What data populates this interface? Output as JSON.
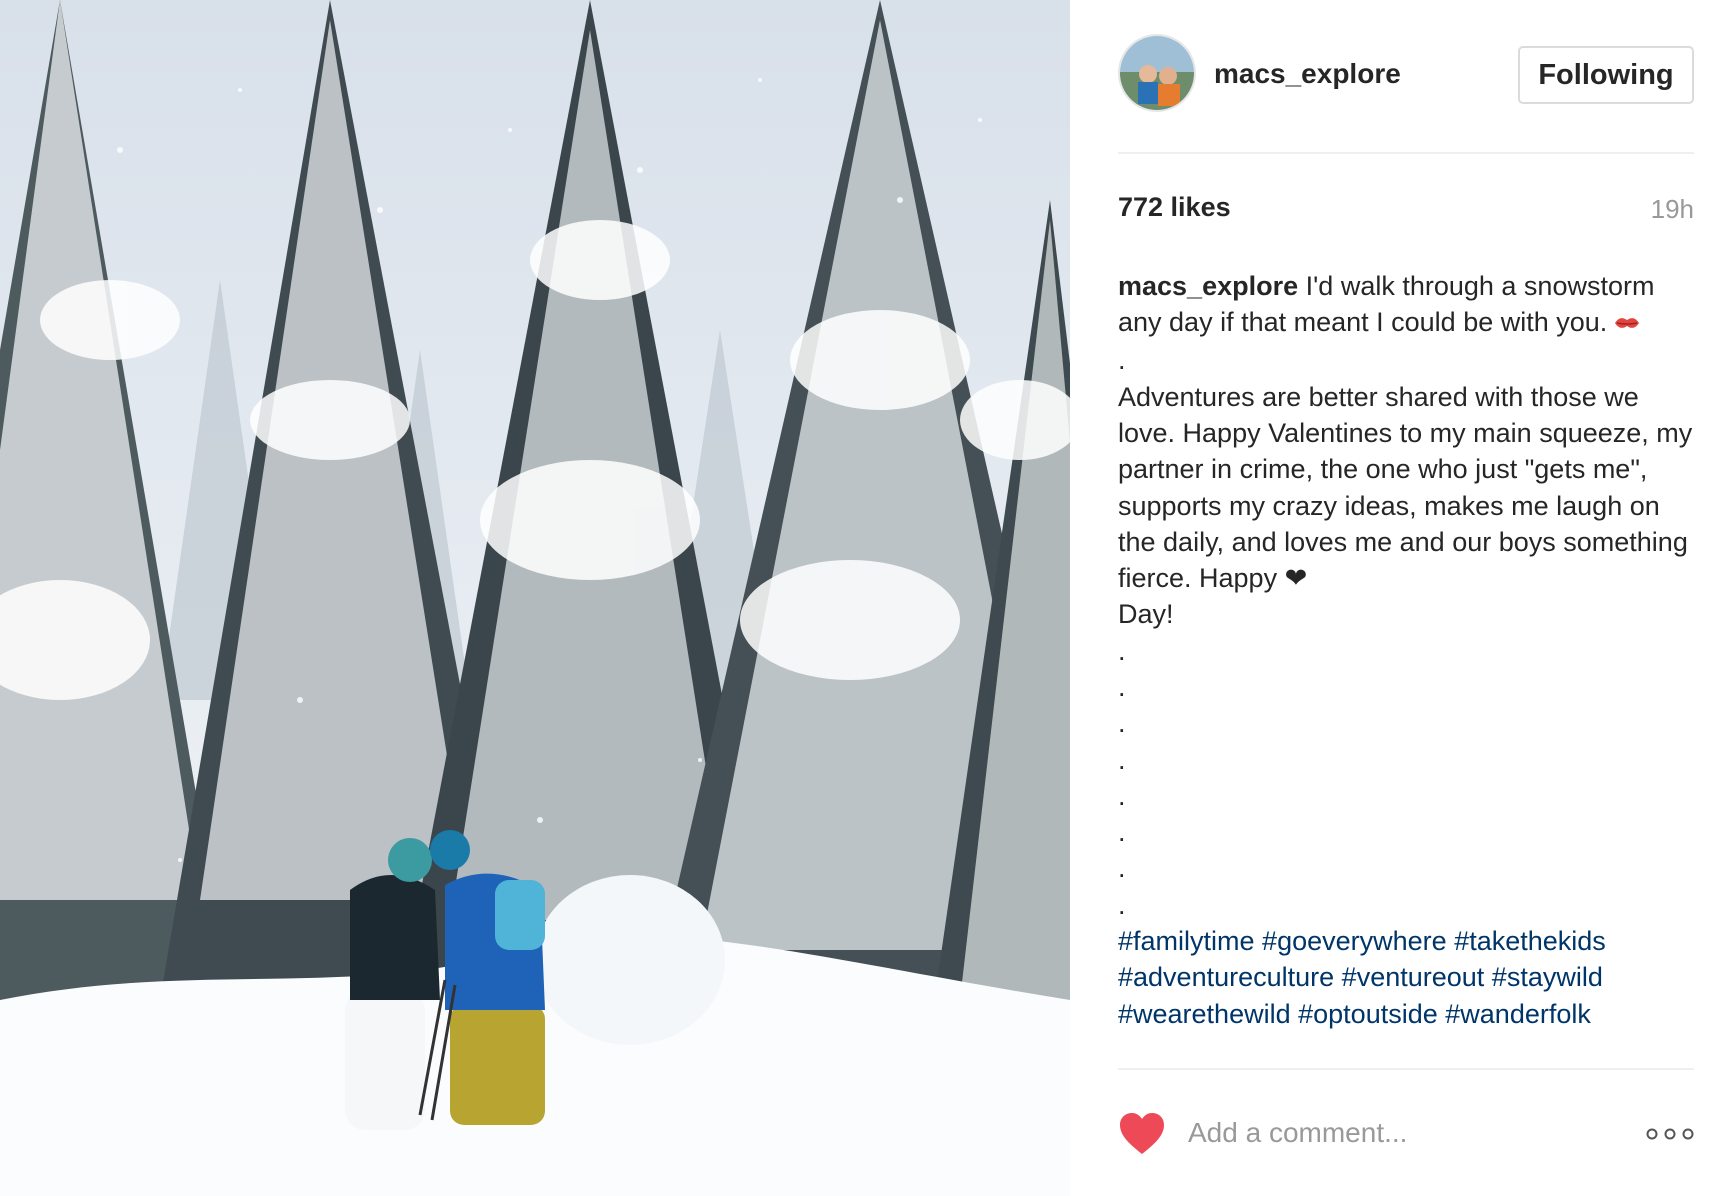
{
  "post": {
    "username": "macs_explore",
    "follow_label": "Following",
    "likes": "772 likes",
    "time": "19h",
    "caption": {
      "author": "macs_explore",
      "line1": "I'd walk through a snowstorm any day if that meant I could be with you.",
      "emoji_kiss": "kiss-mark-icon",
      "dot": ".",
      "para2": "Adventures are better shared with those we love. Happy Valentines to my main squeeze, my partner in crime, the one who just \"gets me\", supports my crazy ideas, makes me laugh on the daily, and loves me and our boys something fierce. Happy",
      "emoji_heart": "❤",
      "para2_end": "Day!",
      "dots": [
        ".",
        ".",
        ".",
        ".",
        ".",
        ".",
        ".",
        "."
      ],
      "hashtags": [
        "#familytime",
        "#goeverywhere",
        "#takethekids",
        "#adventureculture",
        "#ventureout",
        "#staywild",
        "#wearethewild",
        "#optoutside",
        "#wanderfolk"
      ]
    },
    "comment_placeholder": "Add a comment...",
    "icons": {
      "like": "heart-icon",
      "more": "more-options-icon"
    },
    "colors": {
      "heart": "#ed4956",
      "hashtag": "#003569",
      "muted": "#999999"
    }
  }
}
